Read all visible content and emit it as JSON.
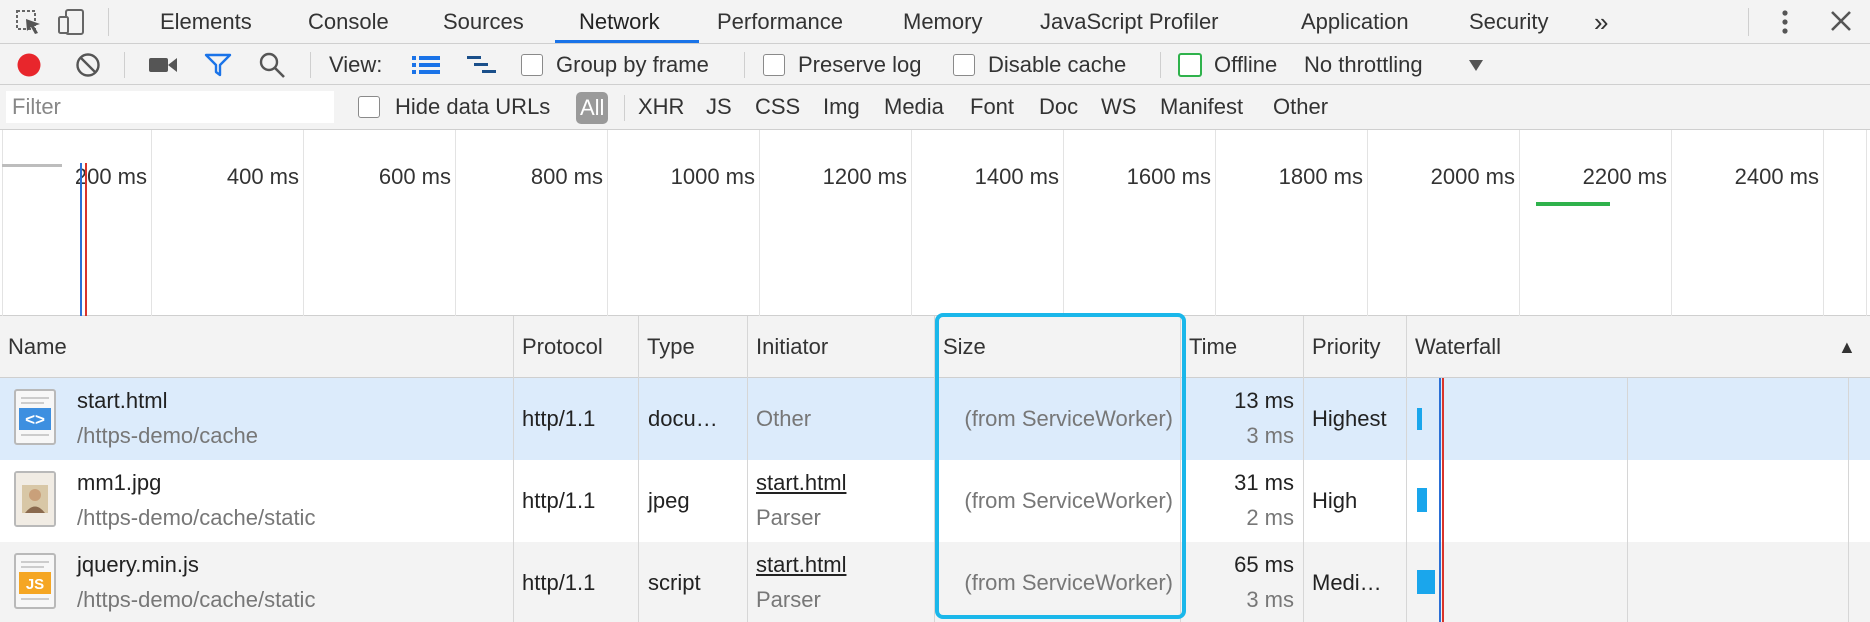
{
  "tabs": [
    "Elements",
    "Console",
    "Sources",
    "Network",
    "Performance",
    "Memory",
    "JavaScript Profiler",
    "Application",
    "Security"
  ],
  "tab_overflow": "»",
  "active_tab": "Network",
  "toolbar": {
    "view_label": "View:",
    "group_by_frame": "Group by frame",
    "preserve_log": "Preserve log",
    "disable_cache": "Disable cache",
    "offline": "Offline",
    "throttling": "No throttling"
  },
  "filterbar": {
    "placeholder": "Filter",
    "hide_data_urls": "Hide data URLs",
    "types": [
      "All",
      "XHR",
      "JS",
      "CSS",
      "Img",
      "Media",
      "Font",
      "Doc",
      "WS",
      "Manifest",
      "Other"
    ]
  },
  "overview": {
    "labels": [
      "200 ms",
      "400 ms",
      "600 ms",
      "800 ms",
      "1000 ms",
      "1200 ms",
      "1400 ms",
      "1600 ms",
      "1800 ms",
      "2000 ms",
      "2200 ms",
      "2400 ms"
    ]
  },
  "table": {
    "headers": [
      "Name",
      "Protocol",
      "Type",
      "Initiator",
      "Size",
      "Time",
      "Priority",
      "Waterfall"
    ],
    "sort_indicator": "▲",
    "rows": [
      {
        "name": "start.html",
        "path": "/https-demo/cache",
        "protocol": "http/1.1",
        "type": "docu…",
        "initiator": "Other",
        "initiator_sub": "",
        "size": "(from ServiceWorker)",
        "time": "13 ms",
        "latency": "3 ms",
        "priority": "Highest",
        "icon": "html-file-icon",
        "icon_glyph": "<>"
      },
      {
        "name": "mm1.jpg",
        "path": "/https-demo/cache/static",
        "protocol": "http/1.1",
        "type": "jpeg",
        "initiator": "start.html",
        "initiator_sub": "Parser",
        "size": "(from ServiceWorker)",
        "time": "31 ms",
        "latency": "2 ms",
        "priority": "High",
        "icon": "image-file-icon",
        "icon_glyph": ""
      },
      {
        "name": "jquery.min.js",
        "path": "/https-demo/cache/static",
        "protocol": "http/1.1",
        "type": "script",
        "initiator": "start.html",
        "initiator_sub": "Parser",
        "size": "(from ServiceWorker)",
        "time": "65 ms",
        "latency": "3 ms",
        "priority": "Medi…",
        "icon": "js-file-icon",
        "icon_glyph": "JS"
      }
    ]
  },
  "colors": {
    "accent": "#1a73e8",
    "record": "#e8262c",
    "offline_border": "#2fb24c",
    "waterfall_bar": "#1aa6ec",
    "size_highlight": "#1ab7ea",
    "selected_row": "#dcebfb"
  }
}
